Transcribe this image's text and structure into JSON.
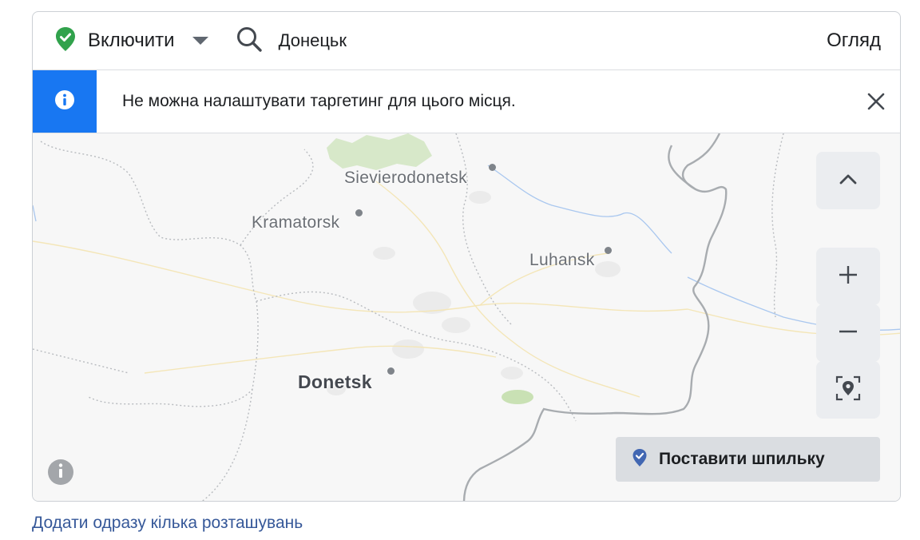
{
  "toolbar": {
    "status_label": "Включити",
    "status_icon": "check-shield-icon",
    "status_color": "#31a24c",
    "search_value": "Донецьк",
    "browse_label": "Огляд"
  },
  "notice": {
    "text": "Не можна налаштувати таргетинг для цього місця.",
    "accent_color": "#1877f2"
  },
  "map": {
    "cities": [
      {
        "name": "Sievierodonetsk"
      },
      {
        "name": "Kramatorsk"
      },
      {
        "name": "Luhansk"
      },
      {
        "name": "Donetsk"
      }
    ],
    "controls": {
      "collapse_icon": "chevron-up-icon",
      "zoom_in_icon": "plus-icon",
      "zoom_out_icon": "minus-icon",
      "locate_icon": "locate-pin-icon"
    },
    "drop_pin_label": "Поставити шпильку",
    "info_icon": "info-icon"
  },
  "footer": {
    "bulk_link": "Додати одразу кілька розташувань",
    "link_color": "#365899"
  }
}
